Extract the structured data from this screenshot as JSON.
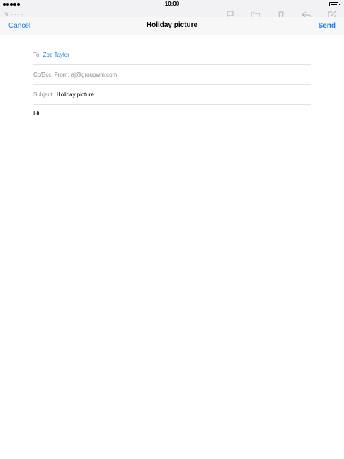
{
  "status_bar": {
    "time": "10:00",
    "signal_dots": 5
  },
  "compose": {
    "cancel_label": "Cancel",
    "title": "Holiday picture",
    "send_label": "Send",
    "to_label": "To:",
    "to_value": "Zoe Taylor",
    "cc_label": "Cc/Bcc, From:",
    "cc_value": "aj@groupwm.com",
    "subject_label": "Subject:",
    "subject_value": "Holiday picture",
    "body": "Hi"
  },
  "colors": {
    "accent": "#1a82e6",
    "secondary_text": "#8e8e93",
    "nav_bg": "#f7f7f8"
  },
  "background_toolbar_icons": [
    "flag-icon",
    "folder-icon",
    "trash-icon",
    "reply-icon",
    "compose-icon"
  ]
}
